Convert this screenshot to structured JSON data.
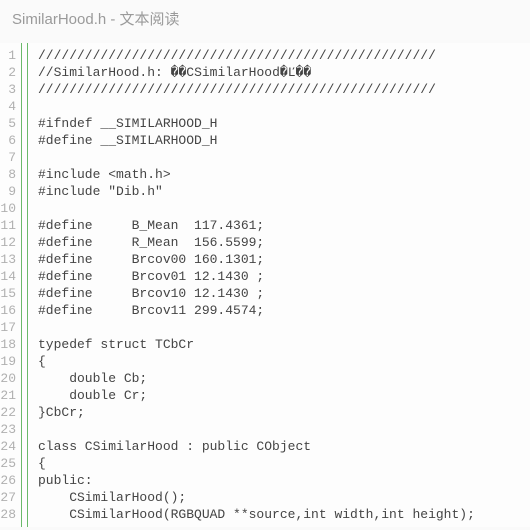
{
  "title": "SimilarHood.h - 文本阅读",
  "code": {
    "lines": [
      "///////////////////////////////////////////////////",
      "//SimilarHood.h: ��CSimilarHood�Ľ��",
      "///////////////////////////////////////////////////",
      "",
      "#ifndef __SIMILARHOOD_H",
      "#define __SIMILARHOOD_H",
      "",
      "#include <math.h>",
      "#include \"Dib.h\"",
      "",
      "#define     B_Mean  117.4361;",
      "#define     R_Mean  156.5599;",
      "#define     Brcov00 160.1301;",
      "#define     Brcov01 12.1430 ;",
      "#define     Brcov10 12.1430 ;",
      "#define     Brcov11 299.4574;",
      "",
      "typedef struct TCbCr",
      "{",
      "    double Cb;",
      "    double Cr;",
      "}CbCr;",
      "",
      "class CSimilarHood : public CObject",
      "{",
      "public:",
      "    CSimilarHood();",
      "    CSimilarHood(RGBQUAD **source,int width,int height);"
    ]
  }
}
